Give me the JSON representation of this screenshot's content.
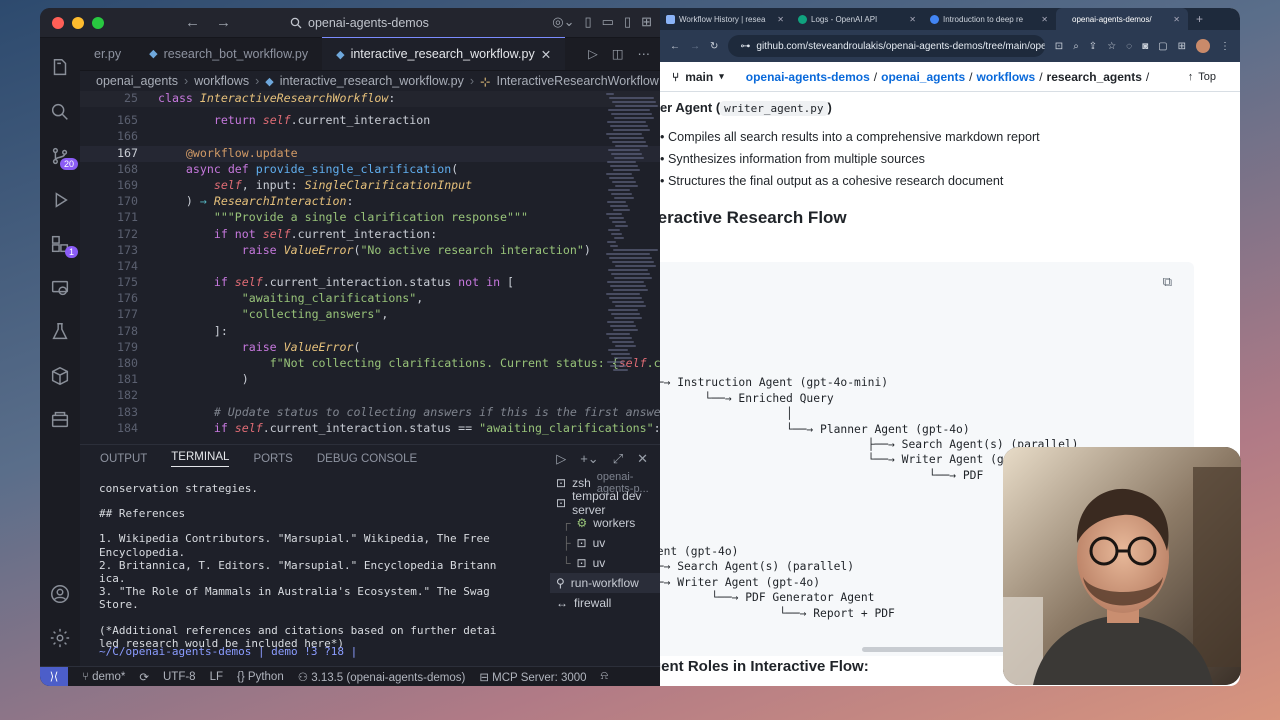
{
  "vscode": {
    "search_text": "openai-agents-demos",
    "tabs": [
      {
        "label": "er.py",
        "active": false
      },
      {
        "label": "research_bot_workflow.py",
        "active": false
      },
      {
        "label": "interactive_research_workflow.py",
        "active": true
      }
    ],
    "breadcrumb": [
      "openai_agents",
      "workflows",
      "interactive_research_workflow.py",
      "InteractiveResearchWorkflow"
    ],
    "activity_badges": {
      "source_control": "20",
      "extensions": "1"
    },
    "code_lines": [
      {
        "n": "25",
        "html": "<span class='kw'>class</span> <span class='cls'>InteractiveResearchWorkflow</span>:"
      },
      {
        "n": "165",
        "html": "        <span class='kw'>return</span> <span class='self'>self</span>.current_interaction"
      },
      {
        "n": "166",
        "html": ""
      },
      {
        "n": "167",
        "html": "    <span class='deco'>@workflow.update</span>"
      },
      {
        "n": "168",
        "html": "    <span class='kw'>async</span> <span class='kw'>def</span> <span class='fn'>provide_single_clarification</span>("
      },
      {
        "n": "169",
        "html": "        <span class='self'>self</span>, input: <span class='tp'>SingleClarificationInput</span>"
      },
      {
        "n": "170",
        "html": "    ) <span class='op'>→</span> <span class='tp'>ResearchInteraction</span>:"
      },
      {
        "n": "171",
        "html": "        <span class='str'>\"\"\"Provide a single clarification response\"\"\"</span>"
      },
      {
        "n": "172",
        "html": "        <span class='kw'>if not</span> <span class='self'>self</span>.current_interaction:"
      },
      {
        "n": "173",
        "html": "            <span class='kw'>raise</span> <span class='tp'>ValueError</span>(<span class='str'>\"No active research interaction\"</span>)"
      },
      {
        "n": "174",
        "html": ""
      },
      {
        "n": "175",
        "html": "        <span class='kw'>if</span> <span class='self'>self</span>.current_interaction.status <span class='kw'>not in</span> ["
      },
      {
        "n": "176",
        "html": "            <span class='str'>\"awaiting_clarifications\"</span>,"
      },
      {
        "n": "177",
        "html": "            <span class='str'>\"collecting_answers\"</span>,"
      },
      {
        "n": "178",
        "html": "        ]:"
      },
      {
        "n": "179",
        "html": "            <span class='kw'>raise</span> <span class='tp'>ValueError</span>("
      },
      {
        "n": "180",
        "html": "                <span class='str'>f\"Not collecting clarifications. Current status: {</span><span class='self'>self</span><span class='str'>.curre</span>"
      },
      {
        "n": "181",
        "html": "            )"
      },
      {
        "n": "182",
        "html": ""
      },
      {
        "n": "183",
        "html": "        <span class='com'># Update status to collecting answers if this is the first answer</span>"
      },
      {
        "n": "184",
        "html": "        <span class='kw'>if</span> <span class='self'>self</span>.current_interaction.status == <span class='str'>\"awaiting_clarifications\"</span>:"
      }
    ],
    "panel_tabs": [
      "OUTPUT",
      "TERMINAL",
      "PORTS",
      "DEBUG CONSOLE"
    ],
    "terminal_lines": [
      "conservation strategies.",
      "## References",
      "1. Wikipedia Contributors. \"Marsupial.\" Wikipedia, The Free\nEncyclopedia.\n2. Britannica, T. Editors. \"Marsupial.\" Encyclopedia Britann\nica.\n3. \"The Role of Mammals in Australia's Ecosystem.\" The Swag\nStore.",
      "(*Additional references and citations based on further detai\nled research would be included here*)"
    ],
    "terminal_prompt": "~/C/openai-agents-demos | demo !3 ?18 |",
    "terminal_list": [
      {
        "label": "zsh",
        "sub": "openai-agents-p...",
        "active": false
      },
      {
        "label": "temporal dev server",
        "sub": "",
        "active": false
      },
      {
        "label": "workers",
        "sub": "",
        "active": false
      },
      {
        "label": "uv",
        "sub": "",
        "active": false
      },
      {
        "label": "uv",
        "sub": "",
        "active": false
      },
      {
        "label": "run-workflow",
        "sub": "",
        "active": true
      },
      {
        "label": "firewall",
        "sub": "",
        "active": false
      }
    ],
    "status": {
      "branch": "demo*",
      "encoding": "UTF-8",
      "eol": "LF",
      "language": "Python",
      "interpreter": "3.13.5 (openai-agents-demos)",
      "mcp": "MCP Server: 3000"
    }
  },
  "browser": {
    "tabs": [
      {
        "label": "Workflow History | resea",
        "color": "#8ab4f8",
        "active": false
      },
      {
        "label": "Logs - OpenAI API",
        "color": "#10a37f",
        "active": false
      },
      {
        "label": "Introduction to deep re",
        "color": "#4285f4",
        "active": false
      },
      {
        "label": "openai-agents-demos/",
        "color": "#e6edf3",
        "active": true
      }
    ],
    "url": "github.com/steveandroulakis/openai-agents-demos/tree/main/openai_...",
    "branch": "main",
    "path": [
      "openai-agents-demos",
      "openai_agents",
      "workflows",
      "research_agents"
    ],
    "top_label": "Top",
    "heading_writer_prefix": "iter Agent",
    "heading_writer_code": "writer_agent.py",
    "bullets": [
      "Compiles all search results into a comprehensive markdown report",
      "Synthesizes information from multiple sources",
      "Structures the final output as a cohesive research document"
    ],
    "heading_flow": "teractive Research Flow",
    "flow_block_1": "t\n──→ Instruction Agent (gpt-4o-mini)\n        └──→ Enriched Query\n                    │\n                    └──→ Planner Agent (gpt-4o)\n                                ├──→ Search Agent(s) (parallel)\n                                └──→ Writer Agent (gpt-4o)\n                                         └──→ PDF",
    "flow_block_2": "gent (gpt-4o)\n──→ Search Agent(s) (parallel)\n──→ Writer Agent (gpt-4o)\n         └──→ PDF Generator Agent\n                   └──→ Report + PDF",
    "heading_roles": "gent Roles in Interactive Flow:"
  }
}
